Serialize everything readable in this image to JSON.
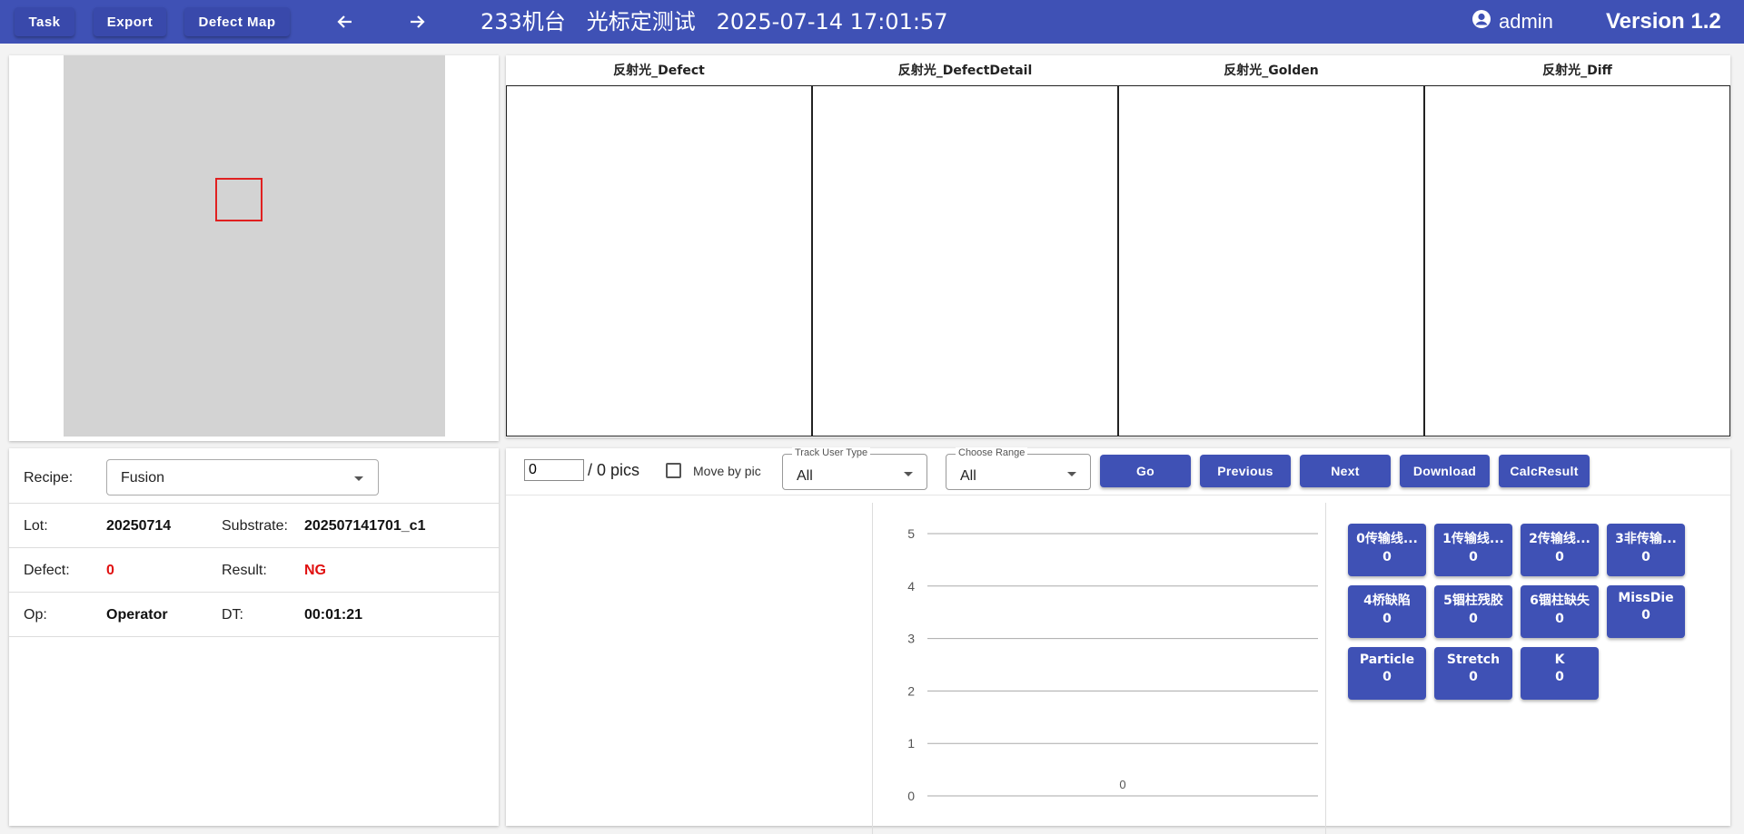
{
  "toolbar": {
    "task_label": "Task",
    "export_label": "Export",
    "defect_map_label": "Defect Map",
    "title": "233机台   光标定测试   2025-07-14 17:01:57",
    "user": "admin",
    "version": "Version 1.2"
  },
  "images": [
    {
      "header": "反射光_Defect"
    },
    {
      "header": "反射光_DefectDetail"
    },
    {
      "header": "反射光_Golden"
    },
    {
      "header": "反射光_Diff"
    }
  ],
  "info": {
    "recipe_label": "Recipe:",
    "recipe_value": "Fusion",
    "lot_label": "Lot:",
    "lot_value": "20250714",
    "substrate_label": "Substrate:",
    "substrate_value": "202507141701_c1",
    "defect_label": "Defect:",
    "defect_value": "0",
    "result_label": "Result:",
    "result_value": "NG",
    "op_label": "Op:",
    "op_value": "Operator",
    "dt_label": "DT:",
    "dt_value": "00:01:21"
  },
  "controls": {
    "pic_index": "0",
    "pic_total": "/ 0 pics",
    "move_by_pic": "Move by pic",
    "track_user_type_label": "Track User Type",
    "track_user_type_value": "All",
    "choose_range_label": "Choose Range",
    "choose_range_value": "All",
    "go": "Go",
    "previous": "Previous",
    "next": "Next",
    "download": "Download",
    "calc_result": "CalcResult"
  },
  "chart_data": {
    "type": "bar",
    "categories": [
      ""
    ],
    "values": [
      0
    ],
    "data_labels": [
      "0"
    ],
    "yticks": [
      "0",
      "1",
      "2",
      "3",
      "4",
      "5"
    ],
    "ylim": [
      0,
      5
    ],
    "grid": true
  },
  "categories": [
    {
      "name": "0传输线...",
      "count": "0"
    },
    {
      "name": "1传输线...",
      "count": "0"
    },
    {
      "name": "2传输线...",
      "count": "0"
    },
    {
      "name": "3非传输...",
      "count": "0"
    },
    {
      "name": "4桥缺陷",
      "count": "0"
    },
    {
      "name": "5锢柱残胶",
      "count": "0"
    },
    {
      "name": "6锢柱缺失",
      "count": "0"
    },
    {
      "name": "MissDie",
      "count": "0"
    },
    {
      "name": "Particle",
      "count": "0"
    },
    {
      "name": "Stretch",
      "count": "0"
    },
    {
      "name": "K",
      "count": "0"
    }
  ]
}
